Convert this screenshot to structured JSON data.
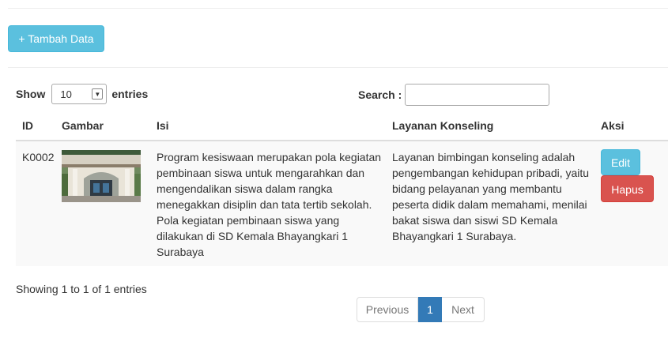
{
  "toolbar": {
    "add_label": "+ Tambah Data"
  },
  "length_menu": {
    "show_label": "Show",
    "selected": "10",
    "entries_label": "entries"
  },
  "search": {
    "label": "Search :",
    "value": ""
  },
  "table": {
    "headers": [
      "ID",
      "Gambar",
      "Isi",
      "Layanan Konseling",
      "Aksi"
    ],
    "rows": [
      {
        "id": "K0002",
        "image": "school-building-photo",
        "isi": "Program kesiswaan merupakan pola kegiatan pembinaan siswa untuk mengarahkan dan mengendalikan siswa dalam rangka menegakkan disiplin dan tata tertib sekolah. Pola kegiatan pembinaan siswa yang dilakukan di SD Kemala Bhayangkari 1 Surabaya",
        "layanan": "Layanan bimbingan konseling adalah pengembangan kehidupan pribadi, yaitu bidang pelayanan yang membantu peserta didik dalam memahami, menilai bakat siswa dan siswi SD Kemala Bhayangkari 1 Surabaya.",
        "edit_label": "Edit",
        "delete_label": "Hapus"
      }
    ]
  },
  "info": "Showing 1 to 1 of 1 entries",
  "pagination": {
    "previous": "Previous",
    "current": "1",
    "next": "Next"
  },
  "colors": {
    "info": "#5bc0de",
    "danger": "#d9534f",
    "primary": "#337ab7"
  }
}
